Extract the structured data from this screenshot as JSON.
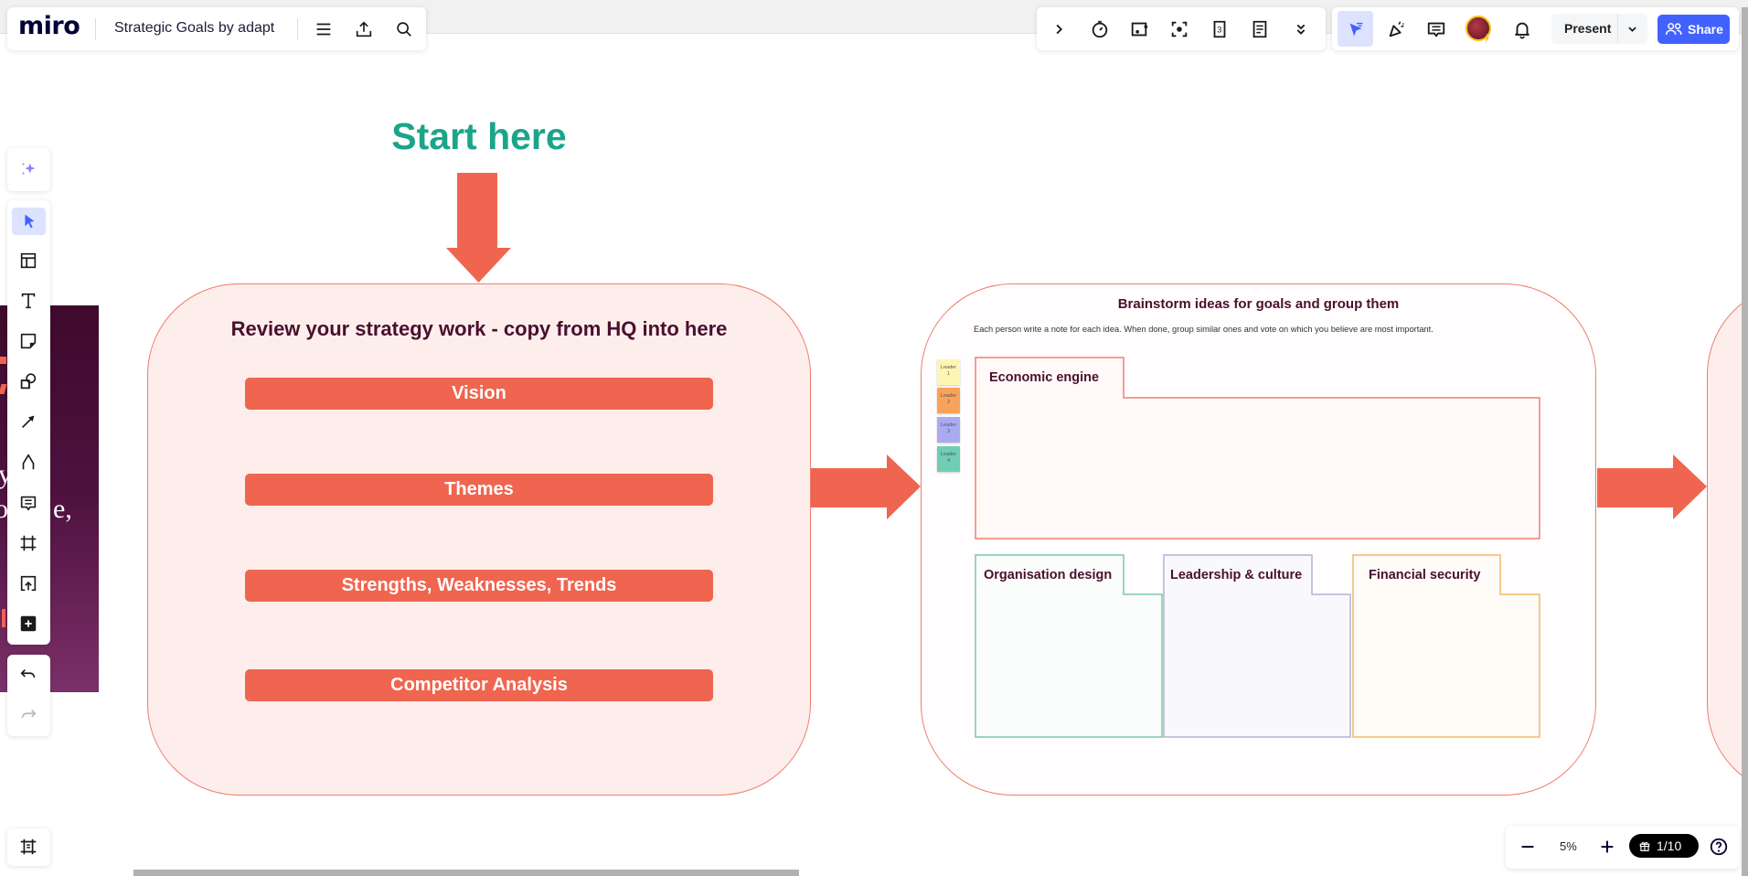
{
  "app": {
    "logo": "miro",
    "board_title": "Strategic Goals by adapt"
  },
  "top_left_toolbar": {
    "icons": [
      "menu-icon",
      "export-icon",
      "search-icon"
    ]
  },
  "top_right_toolbar": {
    "collab_tools": [
      "expand-icon",
      "timer-icon",
      "card-icon",
      "focus-icon",
      "counter-card-icon",
      "notes-icon",
      "more-icon"
    ],
    "present_label": "Present",
    "share_label": "Share",
    "accent": "#4262ff"
  },
  "left_toolbar": {
    "tools": [
      "ai-sparkle",
      "select",
      "templates",
      "text",
      "sticky-note",
      "shapes",
      "connector-arrow",
      "pen",
      "comment",
      "frame",
      "upload",
      "more-apps"
    ],
    "active_tool": "select",
    "history": [
      "undo",
      "redo"
    ]
  },
  "bottom_controls": {
    "zoom_level": "5%",
    "gift_counter": "1/10"
  },
  "canvas": {
    "start_here": "Start here",
    "purple_frame": {
      "fragments": [
        "y",
        "o",
        "e,"
      ]
    },
    "review_box": {
      "title": "Review your strategy work - copy from HQ into here",
      "items": [
        "Vision",
        "Themes",
        "Strengths, Weaknesses, Trends",
        "Competitor Analysis"
      ]
    },
    "brainstorm_box": {
      "title": "Brainstorm ideas for goals and group them",
      "subtitle": "Each person write a note for each idea. When done, group similar ones and vote on which you believe are most important.",
      "leaders": [
        {
          "label": "Leader",
          "number": "1",
          "color": "#fff5b3"
        },
        {
          "label": "Leader",
          "number": "2",
          "color": "#f9a25c"
        },
        {
          "label": "Leader",
          "number": "3",
          "color": "#a9aaf1"
        },
        {
          "label": "Leader",
          "number": "4",
          "color": "#6fceb5"
        }
      ],
      "groups": [
        {
          "label": "Economic engine",
          "color": "#f07f6f"
        },
        {
          "label": "Organisation design",
          "color": "#7ccaa9"
        },
        {
          "label": "Leadership & culture",
          "color": "#b4b1d8"
        },
        {
          "label": "Financial security",
          "color": "#f3b869"
        }
      ]
    }
  },
  "colors": {
    "coral": "#f0654f",
    "start_here_teal": "#1aa58a",
    "heading_maroon": "#4a0f2e",
    "box_fill": "#fdeeec"
  }
}
